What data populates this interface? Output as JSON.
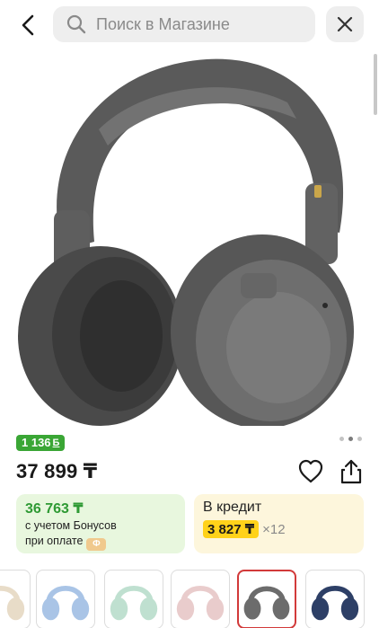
{
  "header": {
    "search_placeholder": "Поиск в Магазине"
  },
  "product": {
    "bonus_badge": "1 136",
    "bonus_badge_icon": "bonus-b-icon",
    "price": "37 899 ₸"
  },
  "bonus_card": {
    "amount": "36 763 ₸",
    "line1": "с учетом Бонусов",
    "line2": "при оплате",
    "coin_label": "Ф"
  },
  "credit_card": {
    "label": "В кредит",
    "monthly": "3 827 ₸",
    "multiplier": "×12"
  },
  "gallery": {
    "selected_index": 4,
    "dots_count": 3,
    "active_dot": 0,
    "thumbnail_colors": [
      "#e8dcc8",
      "#a9c4e6",
      "#bfe0d0",
      "#e9cccc",
      "#6c6c6c",
      "#2d3f66"
    ]
  },
  "colors": {
    "accent_green": "#3aa635",
    "bonus_bg": "#e8f7de",
    "credit_bg": "#fdf6dc",
    "credit_highlight": "#ffd21a",
    "selected_border": "#d23a3a"
  }
}
